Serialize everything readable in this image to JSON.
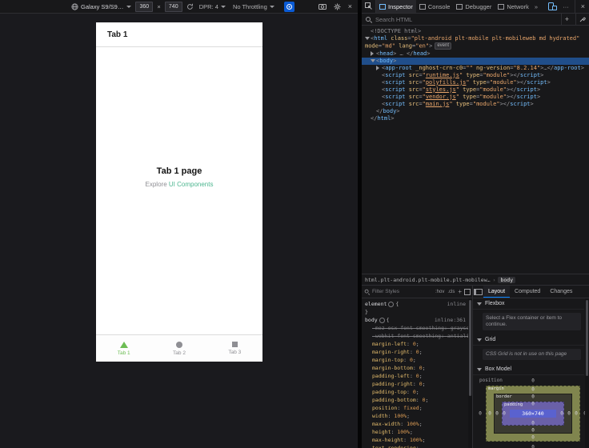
{
  "rdm": {
    "device": "Galaxy S9/S9…",
    "width": "360",
    "height": "740",
    "times": "×",
    "dpr": "DPR: 4",
    "throttling": "No Throttling",
    "close_glyph": "×"
  },
  "device_page": {
    "header_title": "Tab 1",
    "title": "Tab 1 page",
    "subtitle_prefix": "Explore ",
    "subtitle_link": "UI Components",
    "tabs": [
      {
        "label": "Tab 1",
        "icon": "triangle-icon",
        "active": true
      },
      {
        "label": "Tab 2",
        "icon": "circle-icon",
        "active": false
      },
      {
        "label": "Tab 3",
        "icon": "square-icon",
        "active": false
      }
    ],
    "colors": {
      "active_tab": "#6dbd54",
      "link": "#4db690"
    }
  },
  "devtools": {
    "toolbar": {
      "tabs": [
        {
          "label": "Inspector",
          "active": true
        },
        {
          "label": "Console",
          "active": false
        },
        {
          "label": "Debugger",
          "active": false
        },
        {
          "label": "Network",
          "active": false
        }
      ],
      "more_glyph": "»",
      "menu_glyph": "···",
      "close_glyph": "×"
    },
    "search": {
      "placeholder": "Search HTML",
      "add_glyph": "+"
    },
    "markup": {
      "lines": [
        {
          "level": 0,
          "twisty": "",
          "tokens": [
            [
              "d",
              "<!DOCTYPE html>"
            ]
          ]
        },
        {
          "level": 0,
          "twisty": "open",
          "badge": "event",
          "tokens": [
            [
              "p",
              "<"
            ],
            [
              "t",
              "html"
            ],
            [
              "p",
              " "
            ],
            [
              "a",
              "class"
            ],
            [
              "p",
              "="
            ],
            [
              "q",
              "\"plt-android plt-mobile plt-mobileweb md hydrated\""
            ],
            [
              "p",
              " "
            ],
            [
              "a",
              "mode"
            ],
            [
              "p",
              "="
            ],
            [
              "q",
              "\"md\""
            ],
            [
              "p",
              " "
            ],
            [
              "a",
              "lang"
            ],
            [
              "p",
              "="
            ],
            [
              "q",
              "\"en\""
            ],
            [
              "p",
              ">"
            ]
          ]
        },
        {
          "level": 1,
          "twisty": "closed",
          "tokens": [
            [
              "p",
              "<"
            ],
            [
              "t",
              "head"
            ],
            [
              "p",
              ">"
            ],
            [
              "e",
              " … "
            ],
            [
              "p",
              "</"
            ],
            [
              "t",
              "head"
            ],
            [
              "p",
              ">"
            ]
          ]
        },
        {
          "level": 1,
          "twisty": "open",
          "selected": true,
          "tokens": [
            [
              "p",
              "<"
            ],
            [
              "t",
              "body"
            ],
            [
              "p",
              ">"
            ]
          ]
        },
        {
          "level": 2,
          "twisty": "closed",
          "tokens": [
            [
              "p",
              "<"
            ],
            [
              "t",
              "app-root"
            ],
            [
              "p",
              " "
            ],
            [
              "a",
              "_nghost-crn-c0"
            ],
            [
              "p",
              "="
            ],
            [
              "q",
              "\"\""
            ],
            [
              "p",
              " "
            ],
            [
              "a",
              "ng-version"
            ],
            [
              "p",
              "="
            ],
            [
              "q",
              "\"8.2.14\""
            ],
            [
              "p",
              ">"
            ],
            [
              "e",
              "…"
            ],
            [
              "p",
              "</"
            ],
            [
              "t",
              "app-root"
            ],
            [
              "p",
              ">"
            ]
          ]
        },
        {
          "level": 2,
          "twisty": "",
          "tokens": [
            [
              "p",
              "<"
            ],
            [
              "t",
              "script"
            ],
            [
              "p",
              " "
            ],
            [
              "a",
              "src"
            ],
            [
              "p",
              "="
            ],
            [
              "q",
              "\""
            ],
            [
              "u",
              "runtime.js"
            ],
            [
              "q",
              "\""
            ],
            [
              "p",
              " "
            ],
            [
              "a",
              "type"
            ],
            [
              "p",
              "="
            ],
            [
              "q",
              "\"module\""
            ],
            [
              "p",
              ">"
            ],
            [
              "p",
              "</"
            ],
            [
              "t",
              "script"
            ],
            [
              "p",
              ">"
            ]
          ]
        },
        {
          "level": 2,
          "twisty": "",
          "tokens": [
            [
              "p",
              "<"
            ],
            [
              "t",
              "script"
            ],
            [
              "p",
              " "
            ],
            [
              "a",
              "src"
            ],
            [
              "p",
              "="
            ],
            [
              "q",
              "\""
            ],
            [
              "u",
              "polyfills.js"
            ],
            [
              "q",
              "\""
            ],
            [
              "p",
              " "
            ],
            [
              "a",
              "type"
            ],
            [
              "p",
              "="
            ],
            [
              "q",
              "\"module\""
            ],
            [
              "p",
              ">"
            ],
            [
              "p",
              "</"
            ],
            [
              "t",
              "script"
            ],
            [
              "p",
              ">"
            ]
          ]
        },
        {
          "level": 2,
          "twisty": "",
          "tokens": [
            [
              "p",
              "<"
            ],
            [
              "t",
              "script"
            ],
            [
              "p",
              " "
            ],
            [
              "a",
              "src"
            ],
            [
              "p",
              "="
            ],
            [
              "q",
              "\""
            ],
            [
              "u",
              "styles.js"
            ],
            [
              "q",
              "\""
            ],
            [
              "p",
              " "
            ],
            [
              "a",
              "type"
            ],
            [
              "p",
              "="
            ],
            [
              "q",
              "\"module\""
            ],
            [
              "p",
              ">"
            ],
            [
              "p",
              "</"
            ],
            [
              "t",
              "script"
            ],
            [
              "p",
              ">"
            ]
          ]
        },
        {
          "level": 2,
          "twisty": "",
          "tokens": [
            [
              "p",
              "<"
            ],
            [
              "t",
              "script"
            ],
            [
              "p",
              " "
            ],
            [
              "a",
              "src"
            ],
            [
              "p",
              "="
            ],
            [
              "q",
              "\""
            ],
            [
              "u",
              "vendor.js"
            ],
            [
              "q",
              "\""
            ],
            [
              "p",
              " "
            ],
            [
              "a",
              "type"
            ],
            [
              "p",
              "="
            ],
            [
              "q",
              "\"module\""
            ],
            [
              "p",
              ">"
            ],
            [
              "p",
              "</"
            ],
            [
              "t",
              "script"
            ],
            [
              "p",
              ">"
            ]
          ]
        },
        {
          "level": 2,
          "twisty": "",
          "tokens": [
            [
              "p",
              "<"
            ],
            [
              "t",
              "script"
            ],
            [
              "p",
              " "
            ],
            [
              "a",
              "src"
            ],
            [
              "p",
              "="
            ],
            [
              "q",
              "\""
            ],
            [
              "u",
              "main.js"
            ],
            [
              "q",
              "\""
            ],
            [
              "p",
              " "
            ],
            [
              "a",
              "type"
            ],
            [
              "p",
              "="
            ],
            [
              "q",
              "\"module\""
            ],
            [
              "p",
              ">"
            ],
            [
              "p",
              "</"
            ],
            [
              "t",
              "script"
            ],
            [
              "p",
              ">"
            ]
          ]
        },
        {
          "level": 1,
          "twisty": "",
          "tokens": [
            [
              "p",
              "</"
            ],
            [
              "t",
              "body"
            ],
            [
              "p",
              ">"
            ]
          ]
        },
        {
          "level": 0,
          "twisty": "",
          "tokens": [
            [
              "p",
              "</"
            ],
            [
              "t",
              "html"
            ],
            [
              "p",
              ">"
            ]
          ]
        }
      ]
    },
    "breadcrumbs": {
      "items": [
        "html.plt-android.plt-mobile.plt-mobilew…",
        "body"
      ],
      "separator": "›",
      "selected_index": 1
    },
    "rules": {
      "filter_placeholder": "Filter Styles",
      "pseudo_button": ":hov",
      "class_button": ".cls",
      "add_glyph": "+",
      "punct": {
        "colon": ": ",
        "semicolon": ";"
      },
      "element_rule": {
        "selector": "element",
        "open_brace": "{",
        "close_brace": "}",
        "source": "inline"
      },
      "body_rule": {
        "selector": "body",
        "open_brace": "{",
        "source": "inline:361",
        "declarations": [
          {
            "name": "-moz-osx-font-smoothing",
            "value": "grayscale",
            "invalid": true
          },
          {
            "name": "-webkit-font-smoothing",
            "value": "antialiased",
            "invalid": true
          },
          {
            "name": "margin-left",
            "value": "0"
          },
          {
            "name": "margin-right",
            "value": "0"
          },
          {
            "name": "margin-top",
            "value": "0"
          },
          {
            "name": "margin-bottom",
            "value": "0"
          },
          {
            "name": "padding-left",
            "value": "0"
          },
          {
            "name": "padding-right",
            "value": "0"
          },
          {
            "name": "padding-top",
            "value": "0"
          },
          {
            "name": "padding-bottom",
            "value": "0"
          },
          {
            "name": "position",
            "value": "fixed"
          },
          {
            "name": "width",
            "value": "100%"
          },
          {
            "name": "max-width",
            "value": "100%"
          },
          {
            "name": "height",
            "value": "100%"
          },
          {
            "name": "max-height",
            "value": "100%"
          },
          {
            "name": "text-rendering",
            "value": ""
          }
        ]
      }
    },
    "layout_panel": {
      "tabs": [
        {
          "label": "Layout",
          "active": true
        },
        {
          "label": "Computed",
          "active": false
        },
        {
          "label": "Changes",
          "active": false
        }
      ],
      "flexbox": {
        "header": "Flexbox",
        "message": "Select a Flex container or item to continue."
      },
      "grid": {
        "header": "Grid",
        "message": "CSS Grid is not in use on this page"
      },
      "box_model": {
        "header": "Box Model",
        "position_label": "position",
        "content_size": "360×740",
        "labels": {
          "margin": "margin",
          "border": "border",
          "padding": "padding"
        },
        "values": {
          "position": {
            "top": "0",
            "right": "0",
            "bottom": "0",
            "left": "0"
          },
          "margin": {
            "top": "0",
            "right": "0",
            "bottom": "0",
            "left": "0"
          },
          "border": {
            "top": "0",
            "right": "0",
            "bottom": "0",
            "left": "0"
          },
          "padding": {
            "top": "0",
            "right": "0",
            "bottom": "0",
            "left": "0"
          }
        }
      }
    }
  }
}
